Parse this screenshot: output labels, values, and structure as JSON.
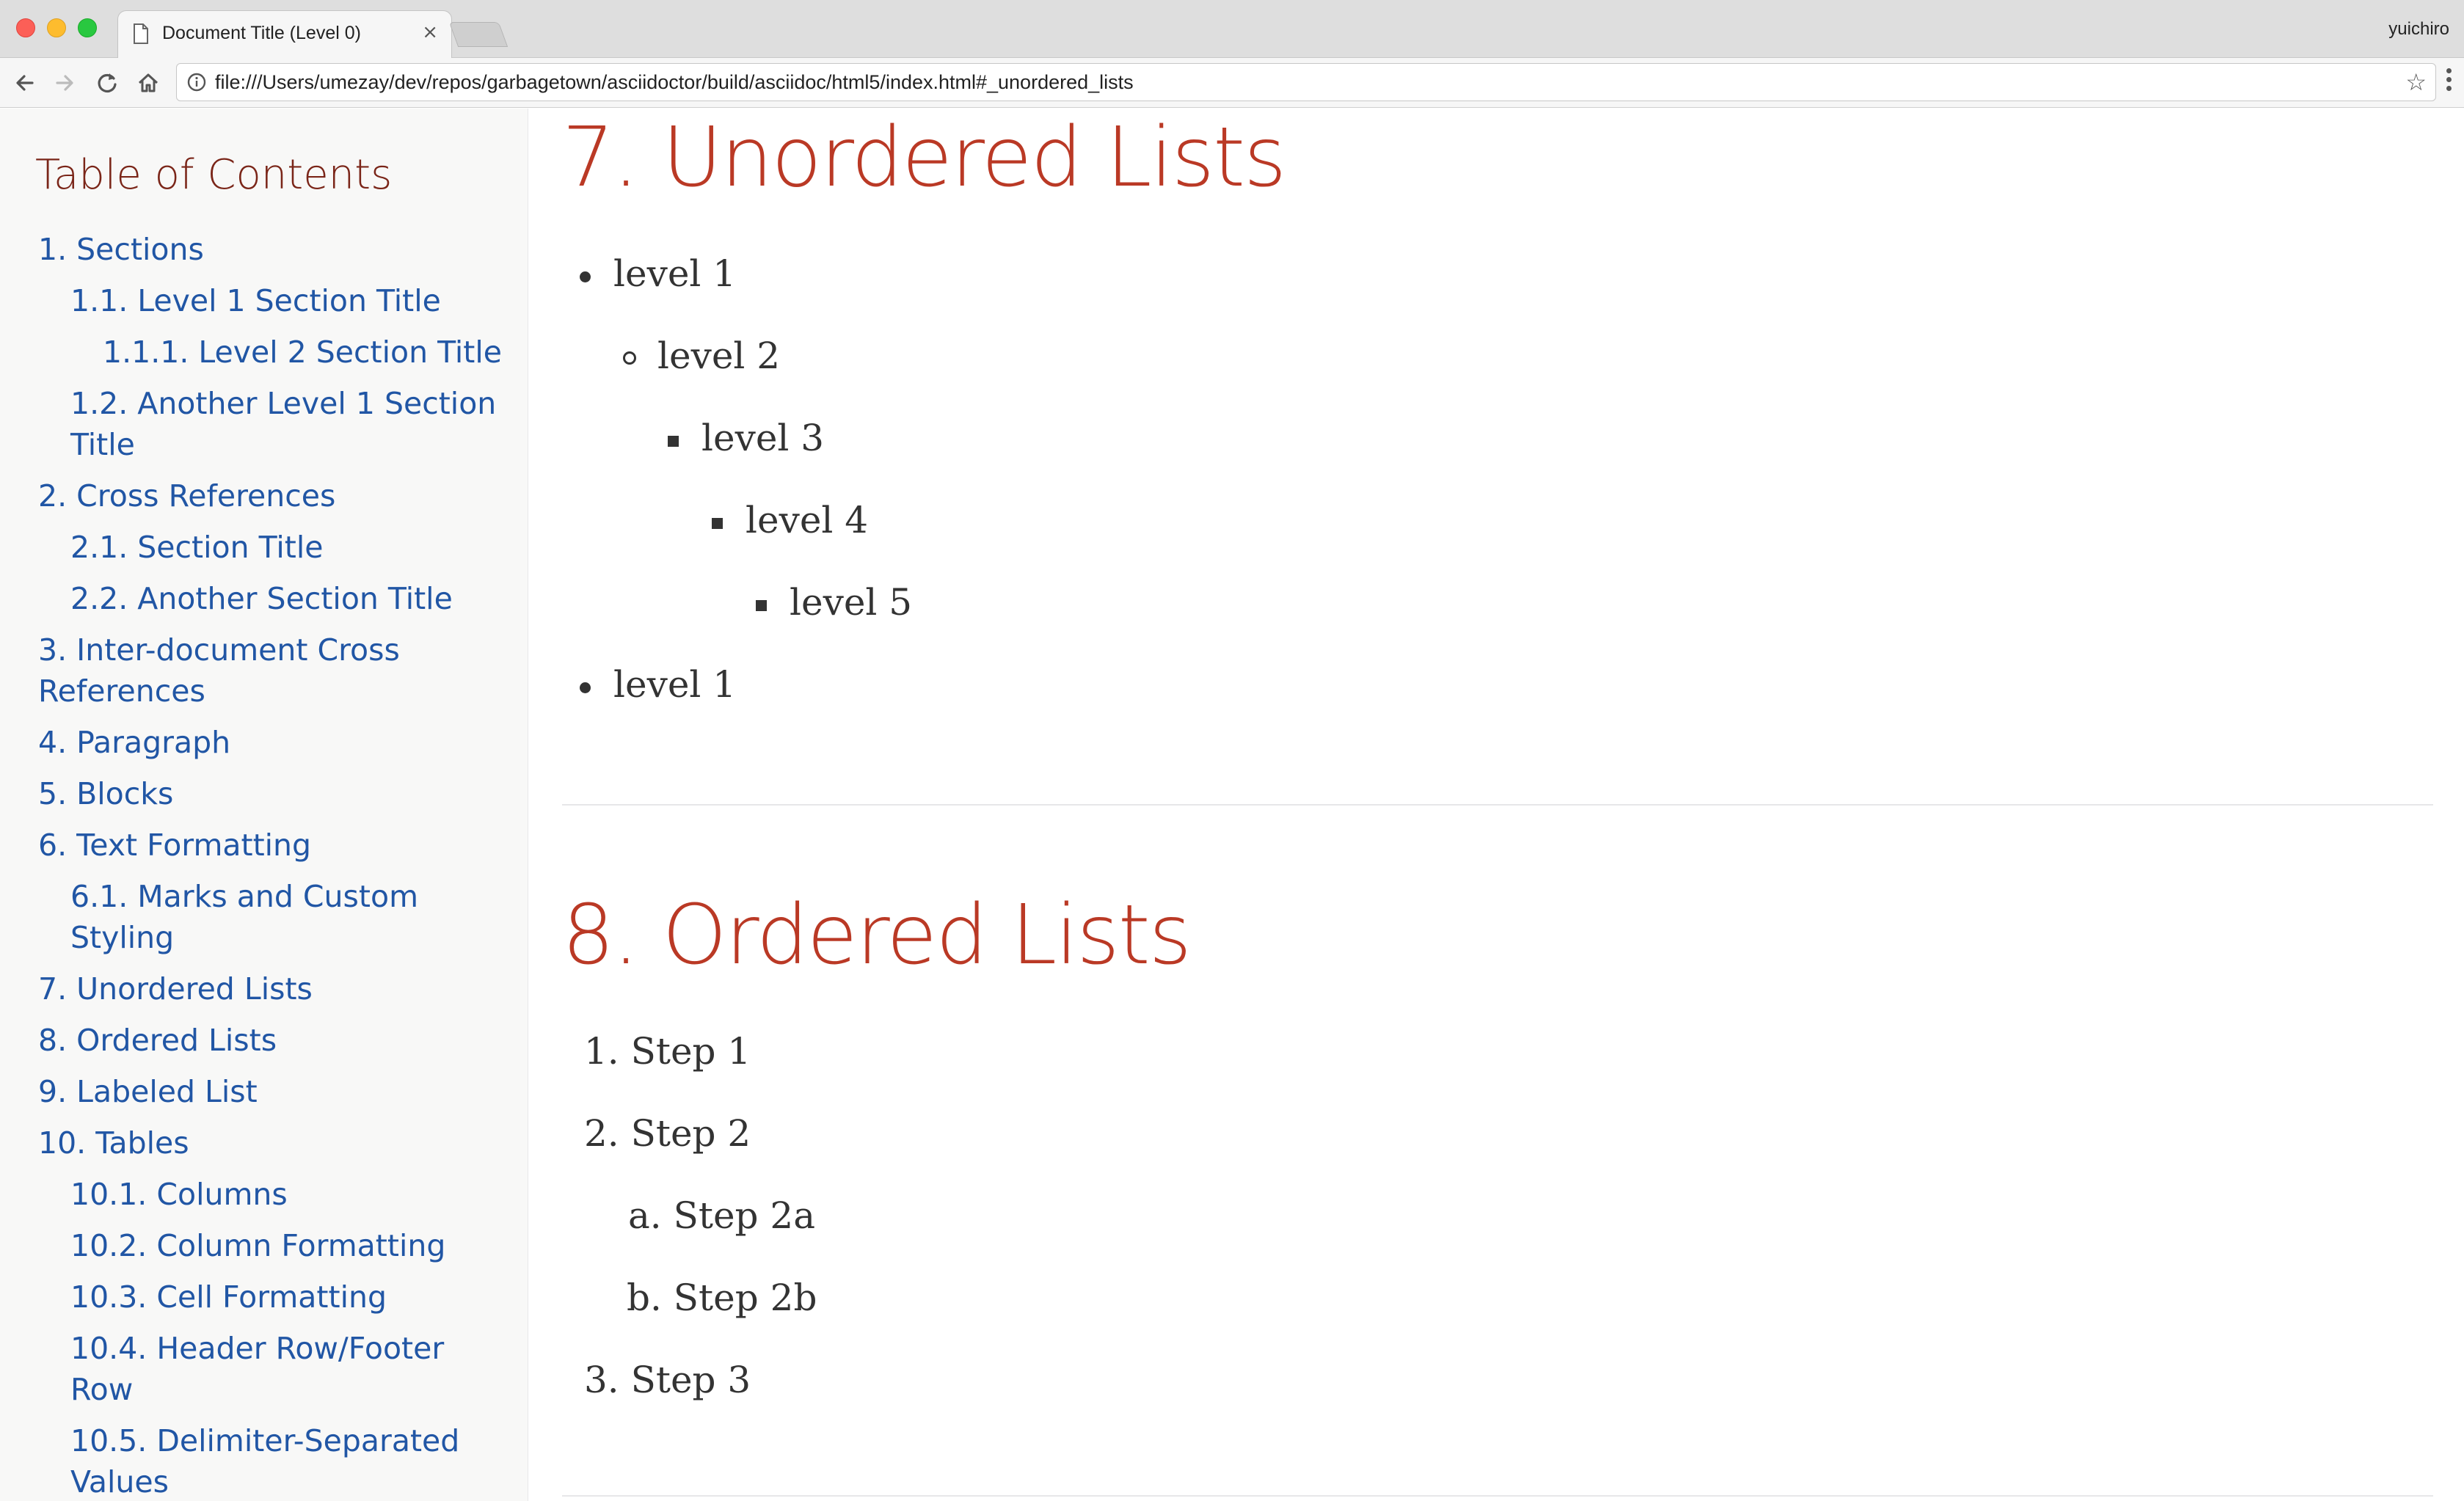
{
  "browser": {
    "tab_title": "Document Title (Level 0)",
    "tab_close": "×",
    "profile_name": "yuichiro",
    "url": "file:///Users/umezay/dev/repos/garbagetown/asciidoctor/build/asciidoc/html5/index.html#_unordered_lists",
    "icons": [
      "back-icon",
      "forward-icon",
      "reload-icon",
      "home-icon",
      "info-icon",
      "star-icon",
      "menu-icon"
    ]
  },
  "toc": {
    "title": "Table of Contents",
    "items": [
      "1. Sections",
      "1.1. Level 1 Section Title",
      "1.1.1. Level 2 Section Title",
      "1.2. Another Level 1 Section Title",
      "2. Cross References",
      "2.1. Section Title",
      "2.2. Another Section Title",
      "3. Inter-document Cross References",
      "4. Paragraph",
      "5. Blocks",
      "6. Text Formatting",
      "6.1. Marks and Custom Styling",
      "7. Unordered Lists",
      "8. Ordered Lists",
      "9. Labeled List",
      "10. Tables",
      "10.1. Columns",
      "10.2. Column Formatting",
      "10.3. Cell Formatting",
      "10.4. Header Row/Footer Row",
      "10.5. Delimiter-Separated Values"
    ]
  },
  "unordered": {
    "heading": "7. Unordered Lists",
    "items": [
      "level 1",
      "level 2",
      "level 3",
      "level 4",
      "level 5",
      "level 1"
    ]
  },
  "ordered": {
    "heading": "8. Ordered Lists",
    "items": [
      "1. Step 1",
      "2. Step 2",
      "a. Step 2a",
      "b. Step 2b",
      "3. Step 3"
    ]
  },
  "colors": {
    "heading": "#ba3925",
    "toc_title": "#7a2518",
    "link": "#2156a5"
  }
}
